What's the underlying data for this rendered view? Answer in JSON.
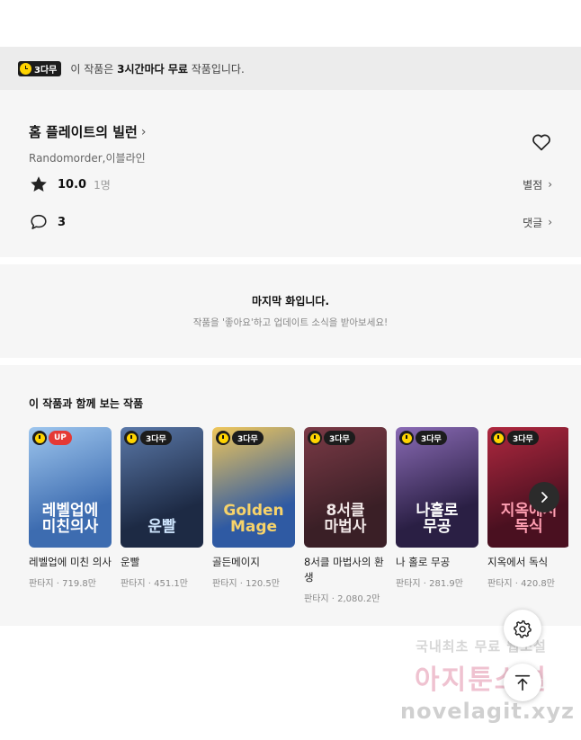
{
  "notice": {
    "badge": "3다무",
    "prefix": "이 작품은 ",
    "bold": "3시간마다 무료",
    "suffix": " 작품입니다."
  },
  "work": {
    "title": "홈 플레이트의 빌런",
    "title_chevron": "›",
    "author": "Randomorder,이블라인",
    "rating": "10.0",
    "rating_count": "1명",
    "rating_link": "별점",
    "comments": "3",
    "comments_link": "댓글"
  },
  "last": {
    "title": "마지막 화입니다.",
    "subtitle": "작품을 '좋아요'하고 업데이트 소식을 받아보세요!"
  },
  "recommend": {
    "title": "이 작품과 함께 보는 작품",
    "items": [
      {
        "title": "레벨업에 미친 의사",
        "meta": "판타지 · 719.8만",
        "badge": "UP",
        "art": "레벨업에\n미친의사",
        "bg": "#3d6cb0",
        "bg2": "#9ec6ee",
        "art_color": "#ffffff"
      },
      {
        "title": "운빨",
        "meta": "판타지 · 451.1만",
        "badge": "3다무",
        "art": "운빨",
        "bg": "#1d2a44",
        "bg2": "#5a78a8",
        "art_color": "#cfe6ff"
      },
      {
        "title": "골든메이지",
        "meta": "판타지 · 120.5만",
        "badge": "3다무",
        "art": "Golden\nMage",
        "bg": "#2f5aa3",
        "bg2": "#f0c75a",
        "art_color": "#f7d36a"
      },
      {
        "title": "8서클 마법사의 환생",
        "meta": "판타지 · 2,080.2만",
        "badge": "3다무",
        "art": "8서클\n마법사",
        "bg": "#3a1f26",
        "bg2": "#7b3a46",
        "art_color": "#f1e7e7"
      },
      {
        "title": "나 홀로 무공",
        "meta": "판타지 · 281.9만",
        "badge": "3다무",
        "art": "나홀로\n무공",
        "bg": "#2a1f44",
        "bg2": "#8a6bb5",
        "art_color": "#ffffff"
      },
      {
        "title": "지옥에서 독식",
        "meta": "판타지 · 420.8만",
        "badge": "3다무",
        "art": "지옥에서\n독식",
        "bg": "#4a1020",
        "bg2": "#b0283f",
        "art_color": "#ff9fb2"
      }
    ]
  },
  "watermark": {
    "line1": "국내최초 무료 웹소설",
    "line2": "아지툰소설",
    "line3": "novelagit.xyz"
  }
}
